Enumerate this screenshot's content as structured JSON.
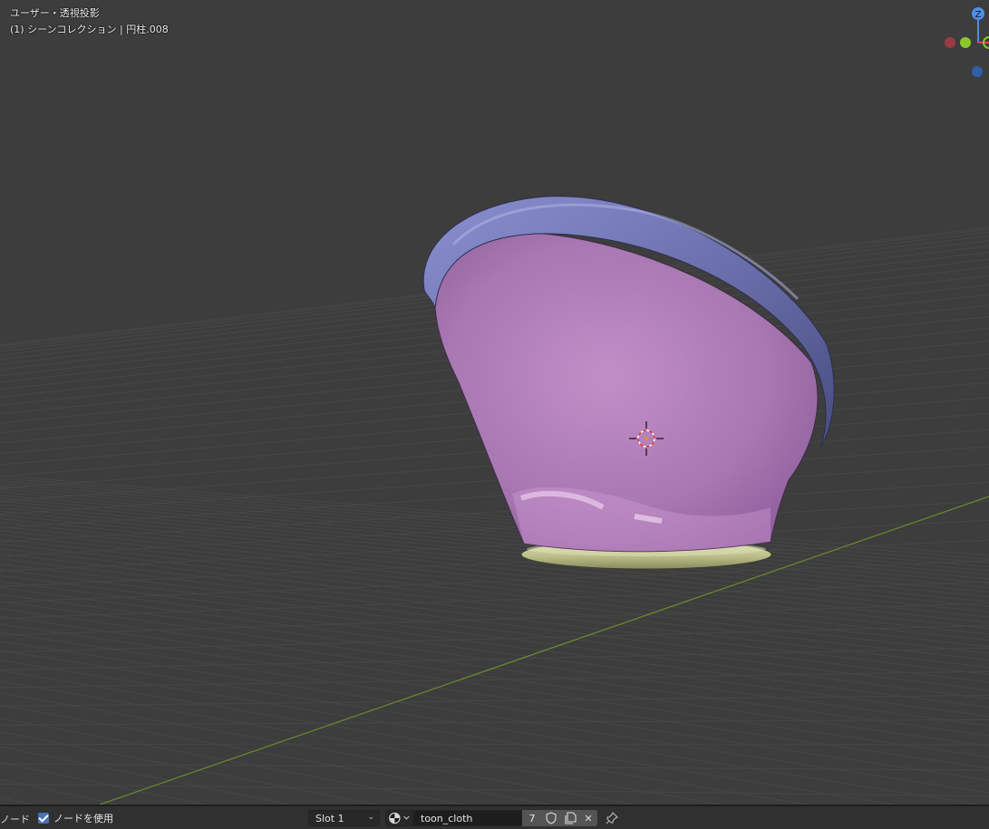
{
  "viewport": {
    "view_mode": "ユーザー・透視投影",
    "collection_info": "(1) シーンコレクション | 円柱.008"
  },
  "gizmo": {
    "z_label": "Z"
  },
  "colors": {
    "background": "#3d3d3d",
    "grid_line": "#494949",
    "x_axis_line": "#6b8a2e",
    "rim_blue": "#6a70a8",
    "body_pink": "#b07cb8",
    "base_yellow": "#c9cc9a",
    "accent": "#4772b3"
  },
  "bottom_bar": {
    "node_label": "ノード",
    "use_nodes_label": "ノードを使用",
    "use_nodes_checked": true,
    "slot_value": "Slot 1",
    "material_name": "toon_cloth",
    "user_count": "7"
  }
}
